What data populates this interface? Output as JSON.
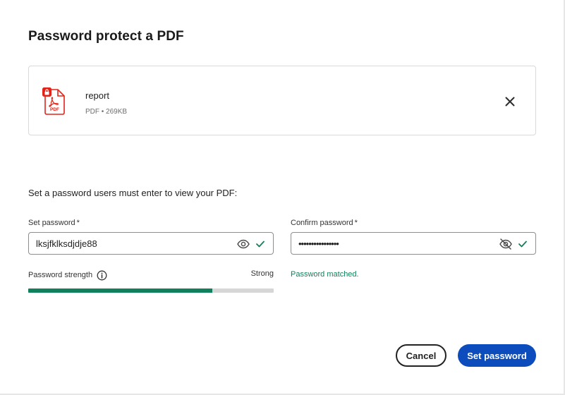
{
  "dialog": {
    "title": "Password protect a PDF"
  },
  "file": {
    "name": "report",
    "meta": "PDF • 269KB",
    "icon": "pdf-locked-icon",
    "icon_badge": "PDF",
    "icon_color": "#e2231a"
  },
  "form": {
    "instructions": "Set a password users must enter to view your PDF:",
    "set_password": {
      "label": "Set password",
      "required_mark": "*",
      "value": "lksjfklksdjdje88",
      "visibility_icon": "eye-icon",
      "valid": true
    },
    "confirm_password": {
      "label": "Confirm password",
      "required_mark": "*",
      "value": "lksjfklksdjdje88",
      "visibility_icon": "eye-off-icon",
      "valid": true
    },
    "strength": {
      "label": "Password strength",
      "value": "Strong",
      "fill_fraction": 0.75,
      "fill_color": "#12805c"
    },
    "match_message": "Password matched."
  },
  "buttons": {
    "cancel": "Cancel",
    "submit": "Set password"
  },
  "colors": {
    "accent": "#0d4cbd",
    "success": "#12805c"
  }
}
